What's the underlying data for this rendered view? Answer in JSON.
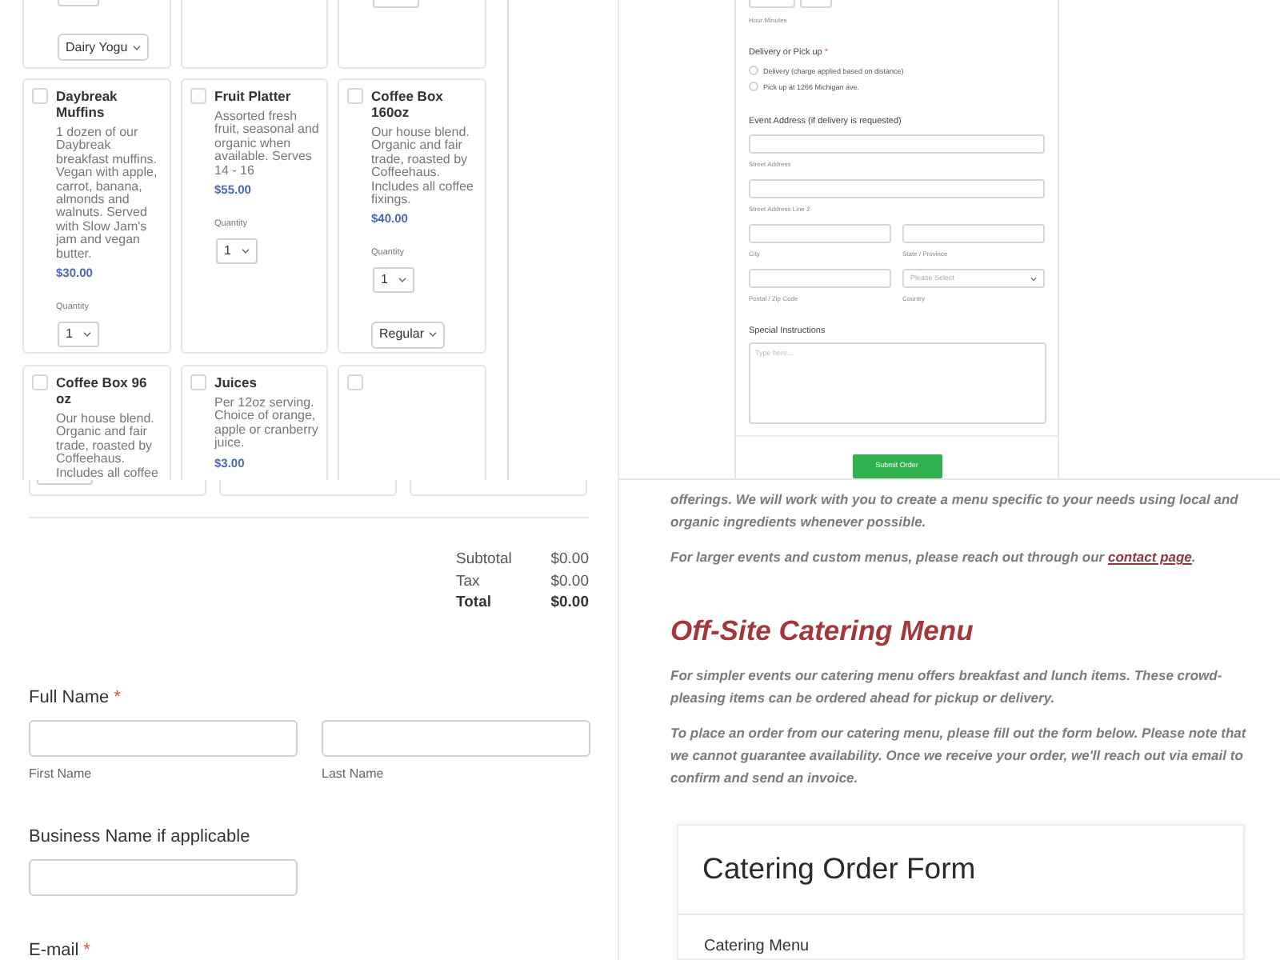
{
  "menu_inset": {
    "cut_row": [
      {
        "kind": "options",
        "variant": "Dairy Yogu"
      },
      {
        "kind": "blank"
      },
      {
        "kind": "options"
      }
    ],
    "items": [
      {
        "name": "Daybreak Muffins",
        "checked": false,
        "description": "1 dozen of our Daybreak breakfast muffins. Vegan with apple, carrot, banana, almonds and walnuts. Served with Slow Jam's jam and vegan butter.",
        "price": "$30.00",
        "quantity_label": "Quantity",
        "quantity": "1"
      },
      {
        "name": "Fruit Platter",
        "checked": false,
        "description": "Assorted fresh fruit, seasonal and organic when available. Serves 14 - 16",
        "price": "$55.00",
        "quantity_label": "Quantity",
        "quantity": "1"
      },
      {
        "name": "Coffee Box 160oz",
        "checked": false,
        "description": "Our house blend. Organic and fair trade, roasted by Coffeehaus. Includes all coffee fixings.",
        "price": "$40.00",
        "quantity_label": "Quantity",
        "quantity": "1",
        "variant": "Regular"
      },
      {
        "name": "Coffee Box 96 oz",
        "checked": false,
        "description": "Our house blend. Organic and fair trade, roasted by Coffeehaus. Includes all coffee"
      },
      {
        "name": "Juices",
        "checked": false,
        "description": "Per 12oz serving. Choice of orange, apple or cranberry juice.",
        "price": "$3.00"
      },
      {
        "checked": false
      }
    ]
  },
  "form_inset": {
    "time_sublabel": "Hour Minutes",
    "delivery": {
      "label": "Delivery or Pick up",
      "required_mark": "*",
      "options": [
        {
          "label": "Delivery (charge applied based on distance)",
          "selected": false
        },
        {
          "label": "Pick up at 1266 Michigan ave.",
          "selected": false
        }
      ]
    },
    "address": {
      "label": "Event Address (if delivery is requested)",
      "rows": [
        {
          "fields": [
            {
              "kind": "input",
              "sublabel": "Street Address"
            }
          ]
        },
        {
          "fields": [
            {
              "kind": "input",
              "sublabel": "Street Address Line 2"
            }
          ]
        },
        {
          "fields": [
            {
              "kind": "input",
              "sublabel": "City"
            },
            {
              "kind": "input",
              "sublabel": "State / Province"
            }
          ]
        },
        {
          "fields": [
            {
              "kind": "input",
              "sublabel": "Postal / Zip Code"
            },
            {
              "kind": "select",
              "placeholder": "Please Select",
              "sublabel": "Country"
            }
          ]
        }
      ]
    },
    "instructions": {
      "label": "Special Instructions",
      "placeholder": "Type here..."
    },
    "submit": "Submit Order"
  },
  "order_summary": [
    {
      "kind": "line",
      "label": "Subtotal",
      "value": "$0.00"
    },
    {
      "kind": "line",
      "label": "Tax",
      "value": "$0.00"
    },
    {
      "kind": "total",
      "label": "Total",
      "value": "$0.00"
    }
  ],
  "customer_fields": [
    {
      "label": "Full Name",
      "required_mark": "*",
      "inputs": [
        {
          "kind": "text",
          "sublabel": "First Name"
        },
        {
          "kind": "text",
          "sublabel": "Last Name"
        }
      ]
    },
    {
      "label": "Business Name if applicable",
      "inputs": [
        {
          "kind": "text"
        }
      ]
    },
    {
      "label": "E-mail",
      "required_mark": "*"
    }
  ],
  "page_text": {
    "intro": [
      {
        "segments": [
          {
            "kind": "text",
            "text": "offerings. We will work with you to create a menu specific to your needs using local and organic ingredients whenever possible."
          }
        ]
      },
      {
        "segments": [
          {
            "kind": "text",
            "text": "For larger events and custom menus, please reach out through our "
          },
          {
            "kind": "link",
            "text": "contact page"
          },
          {
            "kind": "text",
            "text": "."
          }
        ]
      }
    ],
    "heading": "Off-Site Catering Menu",
    "paragraphs": [
      "For simpler events our catering menu offers breakfast and lunch items. These crowd-pleasing items can be ordered ahead for pickup or delivery.",
      "To place an order from our catering menu, please fill out the form below. Please note that we cannot guarantee availability. Once we receive your order, we'll reach out via email to confirm and send an invoice."
    ]
  },
  "order_form_card": {
    "title": "Catering Order Form",
    "section": "Catering Menu"
  }
}
